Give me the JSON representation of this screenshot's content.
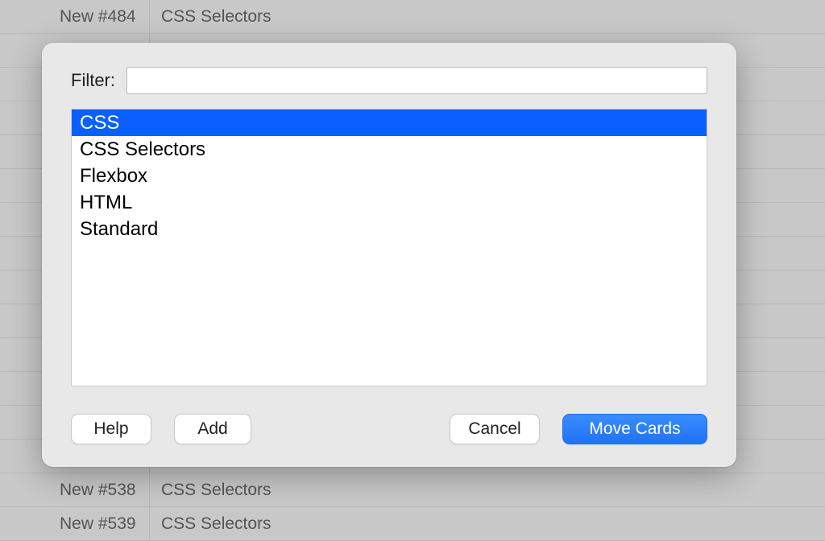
{
  "background": {
    "rows": [
      {
        "col1": "New #484",
        "col2": "CSS Selectors"
      },
      {
        "col1": "",
        "col2": ""
      },
      {
        "col1": "",
        "col2": ""
      },
      {
        "col1": "",
        "col2": ""
      },
      {
        "col1": "",
        "col2": ""
      },
      {
        "col1": "",
        "col2": ""
      },
      {
        "col1": "",
        "col2": ""
      },
      {
        "col1": "",
        "col2": ""
      },
      {
        "col1": "",
        "col2": ""
      },
      {
        "col1": "",
        "col2": ""
      },
      {
        "col1": "",
        "col2": ""
      },
      {
        "col1": "",
        "col2": ""
      },
      {
        "col1": "",
        "col2": ""
      },
      {
        "col1": "",
        "col2": ""
      },
      {
        "col1": "New #538",
        "col2": "CSS Selectors"
      },
      {
        "col1": "New #539",
        "col2": "CSS Selectors"
      }
    ]
  },
  "dialog": {
    "filter_label": "Filter:",
    "filter_value": "",
    "decks": [
      {
        "name": "CSS",
        "selected": true
      },
      {
        "name": "CSS Selectors",
        "selected": false
      },
      {
        "name": "Flexbox",
        "selected": false
      },
      {
        "name": "HTML",
        "selected": false
      },
      {
        "name": "Standard",
        "selected": false
      }
    ],
    "buttons": {
      "help": "Help",
      "add": "Add",
      "cancel": "Cancel",
      "move": "Move Cards"
    }
  }
}
